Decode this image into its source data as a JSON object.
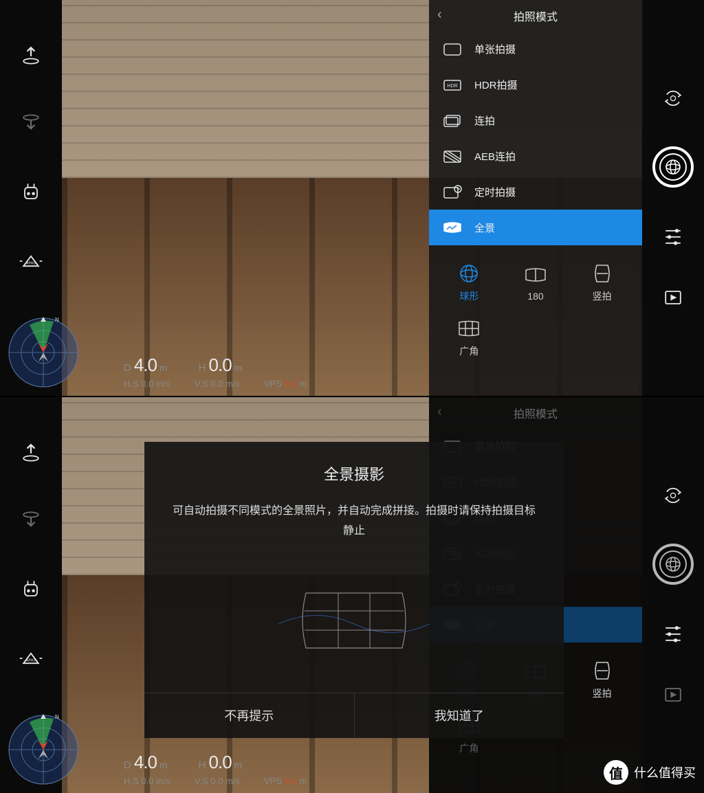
{
  "menu": {
    "title": "拍照模式",
    "items": [
      {
        "label": "单张拍摄"
      },
      {
        "label": "HDR拍摄"
      },
      {
        "label": "连拍"
      },
      {
        "label": "AEB连拍"
      },
      {
        "label": "定时拍摄"
      },
      {
        "label": "全景"
      }
    ],
    "pano_sub": [
      {
        "label": "球形"
      },
      {
        "label": "180"
      },
      {
        "label": "竖拍"
      },
      {
        "label": "广角"
      }
    ]
  },
  "telemetry": {
    "d_label": "D",
    "d_val": "4.0",
    "d_unit": "m",
    "h_label": "H",
    "h_val": "0.0",
    "h_unit": "m",
    "hs_label": "H.S",
    "hs_val": "0.0",
    "hs_unit": "m/s",
    "vs_label": "V.S",
    "vs_val": "0.0",
    "vs_unit": "m/s",
    "vps_label": "VPS",
    "vps_val": "0.1",
    "vps_unit": "m"
  },
  "dialog": {
    "title": "全景摄影",
    "body": "可自动拍摄不同模式的全景照片，并自动完成拼接。拍摄时请保持拍摄目标静止",
    "btn_left": "不再提示",
    "btn_right": "我知道了"
  },
  "watermark": {
    "badge": "值",
    "text": "什么值得买"
  }
}
